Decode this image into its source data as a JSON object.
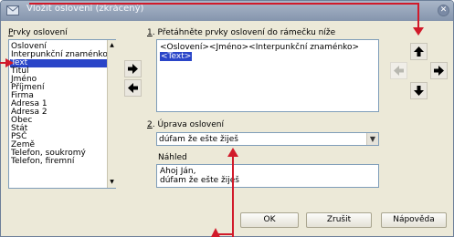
{
  "window": {
    "title": "Vložit oslovení (zkrácený)",
    "close_glyph": "✕"
  },
  "left_panel": {
    "label_underlined": "P",
    "label_rest": "rvky oslovení",
    "items": [
      "Oslovení",
      "Interpunkční znaménko",
      "Text",
      "Titul",
      "Jméno",
      "Příjmení",
      "Firma",
      "Adresa 1",
      "Adresa 2",
      "Obec",
      "Stát",
      "PSČ",
      "Země",
      "Telefon, soukromý",
      "Telefon, firemní"
    ],
    "selected_index": 2
  },
  "arrange": {
    "number": "1",
    "label": ". Přetáhněte prvky oslovení do rámečku níže",
    "line1": "<Oslovení><Jméno><Interpunkční znaménko>",
    "line2": "<Text>"
  },
  "customize": {
    "number": "2",
    "label": ". Úprava oslovení",
    "value": "dúfam že ešte žiješ"
  },
  "preview": {
    "label": "Náhled",
    "line1": "Ahoj Ján,",
    "line2": "dúfam že ešte žiješ"
  },
  "buttons": {
    "ok": "OK",
    "cancel": "Zrušit",
    "help": "Nápověda"
  },
  "icons": {
    "add": "arrow-right-icon",
    "remove": "arrow-left-icon",
    "move_up": "arrow-up-icon",
    "move_down": "arrow-down-icon",
    "move_left": "arrow-left-icon",
    "move_right": "arrow-right-icon"
  },
  "colors": {
    "selection": "#2a45c8",
    "callout": "#d11a2a",
    "titlebar": "#8595ad"
  }
}
